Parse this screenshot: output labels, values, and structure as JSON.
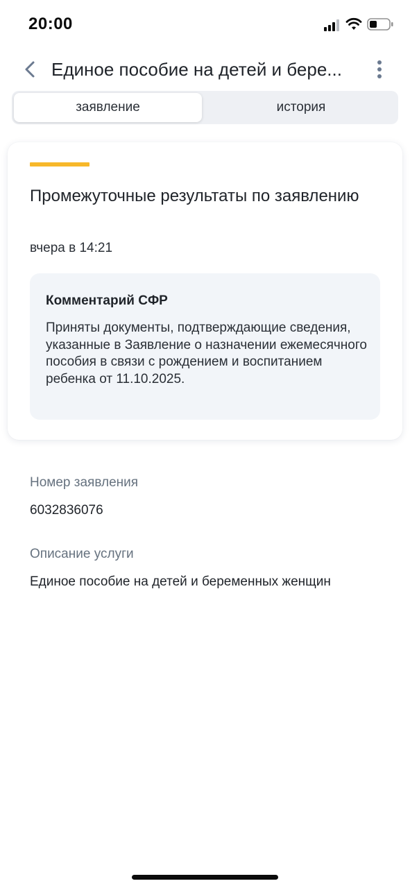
{
  "status_bar": {
    "time": "20:00"
  },
  "header": {
    "title": "Единое пособие на детей и бере..."
  },
  "tabs": [
    {
      "label": "заявление",
      "selected": true
    },
    {
      "label": "история",
      "selected": false
    }
  ],
  "card": {
    "title": "Промежуточные результаты по заявлению",
    "date": "вчера в 14:21",
    "comment": {
      "title": "Комментарий СФР",
      "text": "Приняты документы, подтверждающие сведения, указанные в Заявление о назначении ежемесячного пособия в связи с рождением и воспитанием ребенка от 11.10.2025."
    }
  },
  "fields": {
    "number_label": "Номер заявления",
    "number_value": "6032836076",
    "description_label": "Описание услуги",
    "description_value": "Единое пособие на детей и беременных женщин"
  },
  "colors": {
    "accent": "#f7b82a",
    "comment_bg": "#f2f5f9",
    "label": "#66727f",
    "back_icon": "#6b7a90"
  },
  "icons": [
    "signal-icon",
    "wifi-icon",
    "battery-icon",
    "back-chevron-icon",
    "more-vertical-icon"
  ]
}
